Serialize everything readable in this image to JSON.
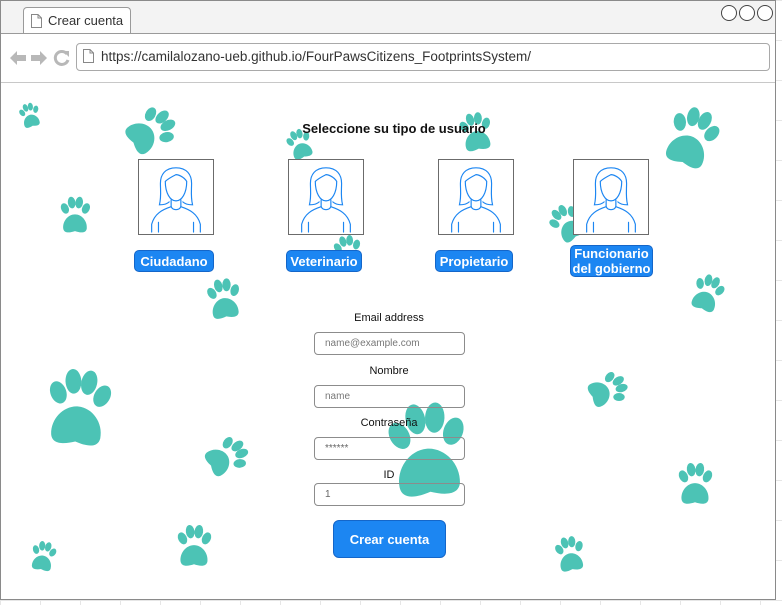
{
  "browser": {
    "tab_title": "Crear cuenta",
    "url": "https://camilalozano-ueb.github.io/FourPawsCitizens_FootprintsSystem/"
  },
  "page": {
    "heading": "Seleccione su tipo de usuario",
    "user_types": [
      {
        "label": "Ciudadano"
      },
      {
        "label": "Veterinario"
      },
      {
        "label": "Propietario"
      },
      {
        "label": "Funcionario del gobierno",
        "line1": "Funcionario",
        "line2": "del gobierno"
      }
    ],
    "form": {
      "email": {
        "label": "Email address",
        "placeholder": "name@example.com"
      },
      "name": {
        "label": "Nombre",
        "placeholder": "name"
      },
      "password": {
        "label": "Contraseña",
        "value": "******"
      },
      "id": {
        "label": "ID",
        "value": "1"
      },
      "submit_label": "Crear cuenta"
    }
  },
  "colors": {
    "accent": "#1c86f2",
    "paw": "#4cc3b5"
  }
}
